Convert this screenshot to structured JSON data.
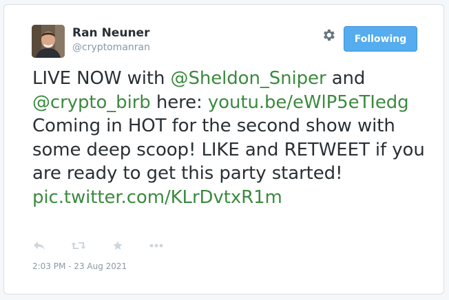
{
  "author": {
    "name": "Ran Neuner",
    "handle": "@cryptomanran"
  },
  "follow_button": {
    "label": "Following"
  },
  "tweet": {
    "segments": [
      {
        "text": "LIVE NOW with ",
        "type": "text"
      },
      {
        "text": "@Sheldon_Sniper",
        "type": "link"
      },
      {
        "text": " and ",
        "type": "text"
      },
      {
        "text": "@crypto_birb",
        "type": "link"
      },
      {
        "text": " here: ",
        "type": "text"
      },
      {
        "text": "youtu.be/eWlP5eTIedg",
        "type": "link"
      },
      {
        "text": " Coming in HOT for the second show with some deep scoop! LIKE and RETWEET if you are ready to get this party started! ",
        "type": "text"
      },
      {
        "text": "pic.twitter.com/KLrDvtxR1m",
        "type": "link"
      }
    ],
    "timestamp": "2:03 PM - 23 Aug 2021"
  },
  "icons": {
    "settings": "gear-icon",
    "reply": "reply-icon",
    "retweet": "retweet-icon",
    "like": "star-icon",
    "more": "more-icon"
  },
  "colors": {
    "link": "#3b8a3e",
    "button_bg": "#55acee",
    "text": "#292f33",
    "muted": "#8899a6",
    "icon": "#ccd6dd"
  }
}
